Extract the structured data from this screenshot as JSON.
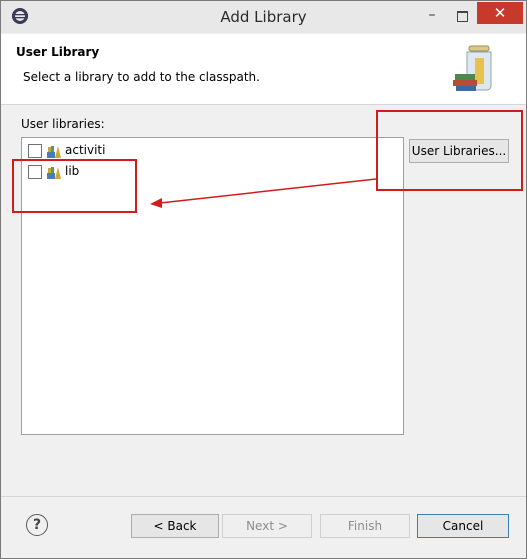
{
  "window": {
    "title": "Add Library",
    "minimize_glyph": "–",
    "close_glyph": "✕"
  },
  "header": {
    "title": "User Library",
    "description": "Select a library to add to the classpath."
  },
  "libraries_label": "User libraries:",
  "libraries": [
    {
      "label": "activiti",
      "checked": false
    },
    {
      "label": "lib",
      "checked": false
    }
  ],
  "buttons": {
    "user_libraries": "User Libraries...",
    "back": "< Back",
    "next": "Next >",
    "finish": "Finish",
    "cancel": "Cancel"
  },
  "help_glyph": "?",
  "annotation_color": "#d21c1c"
}
